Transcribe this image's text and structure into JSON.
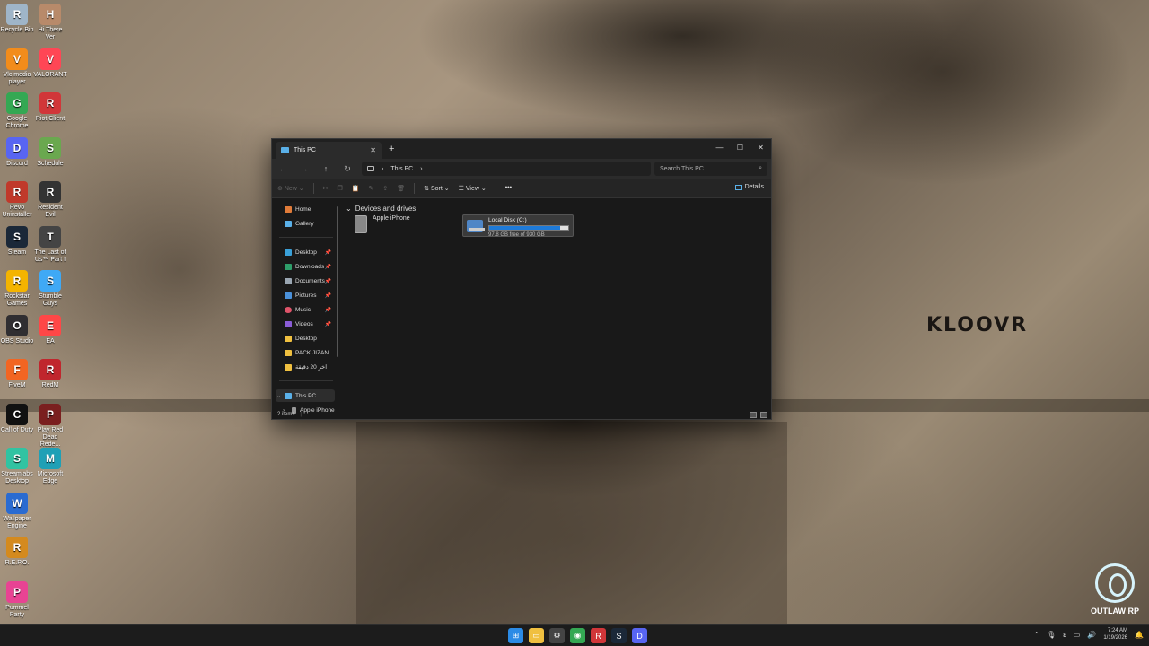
{
  "wallpaper": {
    "text": "KLOOVR",
    "badge": "OUTLAW RP"
  },
  "desktop_icons": [
    {
      "label": "Recycle Bin",
      "icon": "recycle-bin-icon",
      "color": "#9fb5c8"
    },
    {
      "label": "Vlc media player",
      "icon": "vlc-icon",
      "color": "#f28c1b"
    },
    {
      "label": "Google Chrome",
      "icon": "chrome-icon",
      "color": "#34a853"
    },
    {
      "label": "Discord",
      "icon": "discord-icon",
      "color": "#5865f2"
    },
    {
      "label": "Revo Uninstaller",
      "icon": "revo-icon",
      "color": "#c0392b"
    },
    {
      "label": "Steam",
      "icon": "steam-icon",
      "color": "#1b2838"
    },
    {
      "label": "Rockstar Games",
      "icon": "rockstar-icon",
      "color": "#f4b400"
    },
    {
      "label": "OBS Studio",
      "icon": "obs-icon",
      "color": "#302e31"
    },
    {
      "label": "FiveM",
      "icon": "fivem-icon",
      "color": "#f26522"
    },
    {
      "label": "Call of Duty",
      "icon": "cod-icon",
      "color": "#111111"
    },
    {
      "label": "Streamlabs Desktop",
      "icon": "streamlabs-icon",
      "color": "#31c3a2"
    },
    {
      "label": "Wallpaper Engine",
      "icon": "wallpaper-engine-icon",
      "color": "#2a6bd1"
    },
    {
      "label": "R.E.P.O.",
      "icon": "repo-icon",
      "color": "#d48a1e"
    },
    {
      "label": "Pummel Party",
      "icon": "pummel-party-icon",
      "color": "#e84393"
    },
    {
      "label": "Hi There Ver",
      "icon": "hi-there-icon",
      "color": "#b88a6a"
    },
    {
      "label": "VALORANT",
      "icon": "valorant-icon",
      "color": "#ff4655"
    },
    {
      "label": "Riot Client",
      "icon": "riot-icon",
      "color": "#d13639"
    },
    {
      "label": "Schedule",
      "icon": "schedule-icon",
      "color": "#6aa84f"
    },
    {
      "label": "Resident Evil",
      "icon": "resident-evil-icon",
      "color": "#333333"
    },
    {
      "label": "The Last of Us™ Part I",
      "icon": "tlou-icon",
      "color": "#444444"
    },
    {
      "label": "Stumble Guys",
      "icon": "stumble-guys-icon",
      "color": "#3fa9f5"
    },
    {
      "label": "EA",
      "icon": "ea-icon",
      "color": "#ff4747"
    },
    {
      "label": "RedM",
      "icon": "redm-icon",
      "color": "#c0262d"
    },
    {
      "label": "Play Red Dead Rede...",
      "icon": "rdr-icon",
      "color": "#7a1f1f"
    },
    {
      "label": "Microsoft Edge",
      "icon": "edge-icon",
      "color": "#1fa0b6"
    }
  ],
  "explorer": {
    "tab_title": "This PC",
    "path_items": [
      "This PC"
    ],
    "search_placeholder": "Search This PC",
    "commands": {
      "new": "New",
      "sort": "Sort",
      "view": "View",
      "more": "•••",
      "details": "Details"
    },
    "nav": {
      "home": "Home",
      "gallery": "Gallery",
      "pinned": [
        "Desktop",
        "Downloads",
        "Documents",
        "Pictures",
        "Music",
        "Videos"
      ],
      "folders": [
        "Desktop",
        "PACK JIZAN",
        "اخر 20 دقيقة"
      ],
      "this_pc": "This PC",
      "apple_iphone": "Apple iPhone"
    },
    "section_title": "Devices and drives",
    "devices": [
      {
        "name": "Apple iPhone"
      }
    ],
    "drive": {
      "name": "Local Disk (C:)",
      "free_text": "97.8 GB free of 930 GB",
      "used_fraction": 0.895
    },
    "status": "2 items"
  },
  "taskbar": {
    "apps": [
      "windows-start-icon",
      "file-explorer-icon",
      "settings-icon",
      "chrome-icon",
      "riot-icon",
      "steam-icon",
      "discord-icon"
    ],
    "clock_time": "7:24 AM",
    "clock_date": "1/19/2026"
  }
}
